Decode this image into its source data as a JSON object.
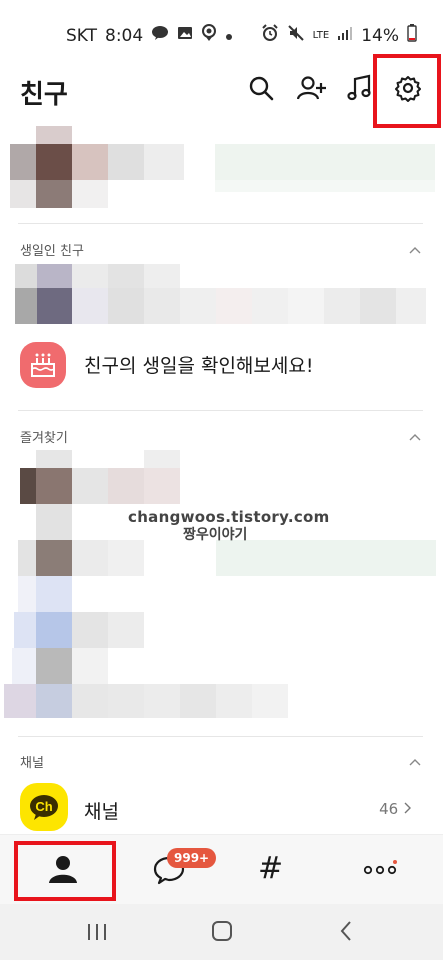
{
  "status_bar": {
    "carrier": "SKT",
    "time": "8:04",
    "network": "LTE",
    "battery": "14%"
  },
  "header": {
    "title": "친구"
  },
  "sections": {
    "birthday": {
      "label": "생일인 친구",
      "prompt": "친구의 생일을 확인해보세요!"
    },
    "favorites": {
      "label": "즐겨찾기"
    },
    "channel": {
      "label": "채널",
      "item_label": "채널",
      "icon_text": "Ch",
      "count": "46"
    }
  },
  "watermark": {
    "line1": "changwoos.tistory.com",
    "line2": "짱우이야기"
  },
  "tabbar": {
    "chat_badge": "999+"
  },
  "colors": {
    "highlight_box": "#e8141c",
    "birthday_icon": "#f06b6e",
    "channel_icon": "#fde500",
    "badge": "#e5573f"
  }
}
